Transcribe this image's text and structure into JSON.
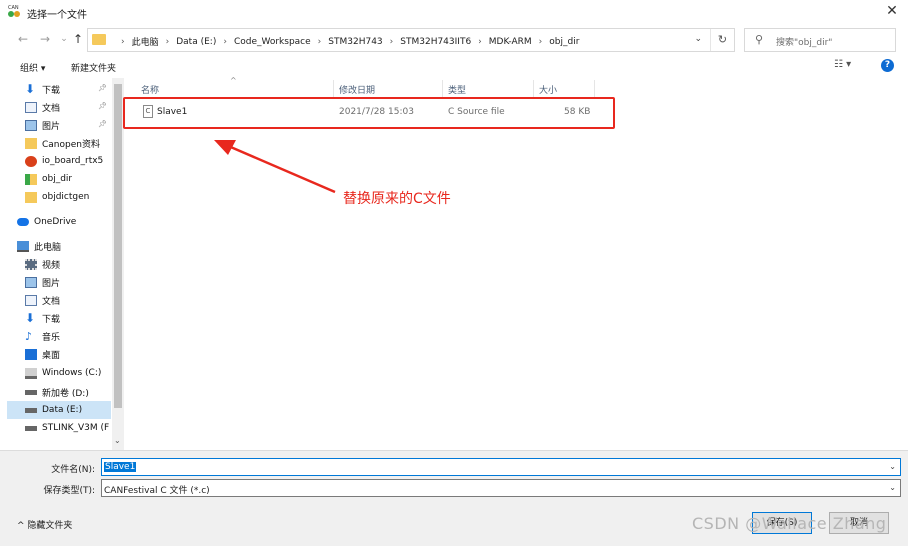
{
  "window": {
    "title": "选择一个文件",
    "close_label": "✕"
  },
  "address": {
    "crumbs": [
      "此电脑",
      "Data (E:)",
      "Code_Workspace",
      "STM32H743",
      "STM32H743IIT6",
      "MDK-ARM",
      "obj_dir"
    ],
    "search_placeholder": "搜索\"obj_dir\""
  },
  "toolbar": {
    "organize": "组织 ▾",
    "new_folder": "新建文件夹"
  },
  "sidebar": {
    "items": [
      {
        "label": "下载",
        "icon": "download-arrow-icon",
        "pinned": true
      },
      {
        "label": "文档",
        "icon": "document-icon",
        "pinned": true
      },
      {
        "label": "图片",
        "icon": "picture-icon",
        "pinned": true
      },
      {
        "label": "Canopen资料",
        "icon": "folder-icon"
      },
      {
        "label": "io_board_rtx5",
        "icon": "project-icon"
      },
      {
        "label": "obj_dir",
        "icon": "folder-check-icon"
      },
      {
        "label": "objdictgen",
        "icon": "folder-icon"
      },
      {
        "label": "OneDrive",
        "icon": "cloud-icon"
      },
      {
        "label": "此电脑",
        "icon": "computer-icon"
      },
      {
        "label": "视频",
        "icon": "video-icon"
      },
      {
        "label": "图片",
        "icon": "picture-icon"
      },
      {
        "label": "文档",
        "icon": "document-icon"
      },
      {
        "label": "下载",
        "icon": "download-arrow-icon"
      },
      {
        "label": "音乐",
        "icon": "music-icon"
      },
      {
        "label": "桌面",
        "icon": "desktop-icon"
      },
      {
        "label": "Windows (C:)",
        "icon": "windows-drive-icon"
      },
      {
        "label": "新加卷 (D:)",
        "icon": "drive-icon"
      },
      {
        "label": "Data (E:)",
        "icon": "drive-icon",
        "selected": true
      },
      {
        "label": "STLINK_V3M (F",
        "icon": "drive-icon"
      }
    ]
  },
  "columns": {
    "name": "名称",
    "date": "修改日期",
    "type": "类型",
    "size": "大小"
  },
  "files": [
    {
      "name": "Slave1",
      "date": "2021/7/28 15:03",
      "type": "C Source file",
      "size": "58 KB",
      "icon_text": "C"
    }
  ],
  "annotation": {
    "text": "替换原来的C文件",
    "color": "#e8281e"
  },
  "footer": {
    "filename_label": "文件名(N):",
    "filename_value": "Slave1",
    "filetype_label": "保存类型(T):",
    "filetype_value": "CANFestival C 文件 (*.c)",
    "hide_folders": "隐藏文件夹",
    "save_button": "保存(S)",
    "cancel_button": "取消"
  },
  "watermark": "CSDN @Wallace Zhang"
}
